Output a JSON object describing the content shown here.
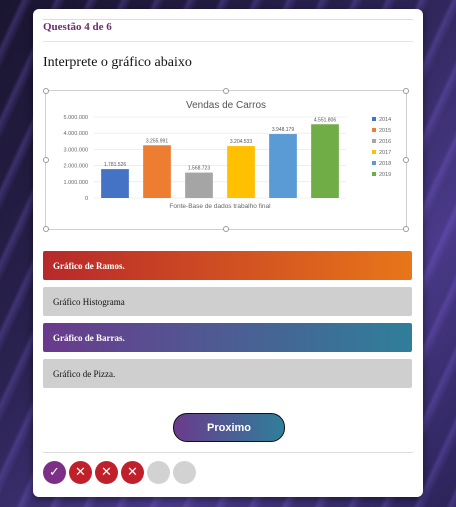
{
  "question": {
    "header": "Questão 4 de 6",
    "prompt": "Interprete o gráfico abaixo"
  },
  "chart_data": {
    "type": "bar",
    "title": "Vendas de Carros",
    "caption": "Fonte-Base de dados trabalho final",
    "categories": [
      "2014",
      "2015",
      "2016",
      "2017",
      "2018",
      "2019"
    ],
    "values": [
      1781526,
      3255991,
      1568723,
      3204533,
      3948179,
      4551806
    ],
    "labels": [
      "1.781.526",
      "3.255.991",
      "1.568.723",
      "3.204.533",
      "3.948.179",
      "4.551.806"
    ],
    "colors": [
      "#4472c4",
      "#ed7d31",
      "#a5a5a5",
      "#ffc000",
      "#5b9bd5",
      "#70ad47"
    ],
    "yticks": [
      "5.000.000",
      "4.000.000",
      "3.000.000",
      "2.000.000",
      "1.000.000",
      "0"
    ],
    "ylim": [
      0,
      5000000
    ],
    "legend": "right",
    "grid": true
  },
  "options": [
    {
      "label": "Gráfico de Ramos.",
      "style": "orange"
    },
    {
      "label": "Gráfico Histograma",
      "style": "gray"
    },
    {
      "label": "Gráfico de Barras.",
      "style": "purple"
    },
    {
      "label": "Gráfico de Pizza.",
      "style": "gray"
    }
  ],
  "next_label": "Proximo",
  "progress": [
    "correct",
    "wrong",
    "wrong",
    "wrong",
    "pending",
    "pending"
  ],
  "progress_icons": {
    "correct": "check-icon",
    "wrong": "x-icon"
  }
}
